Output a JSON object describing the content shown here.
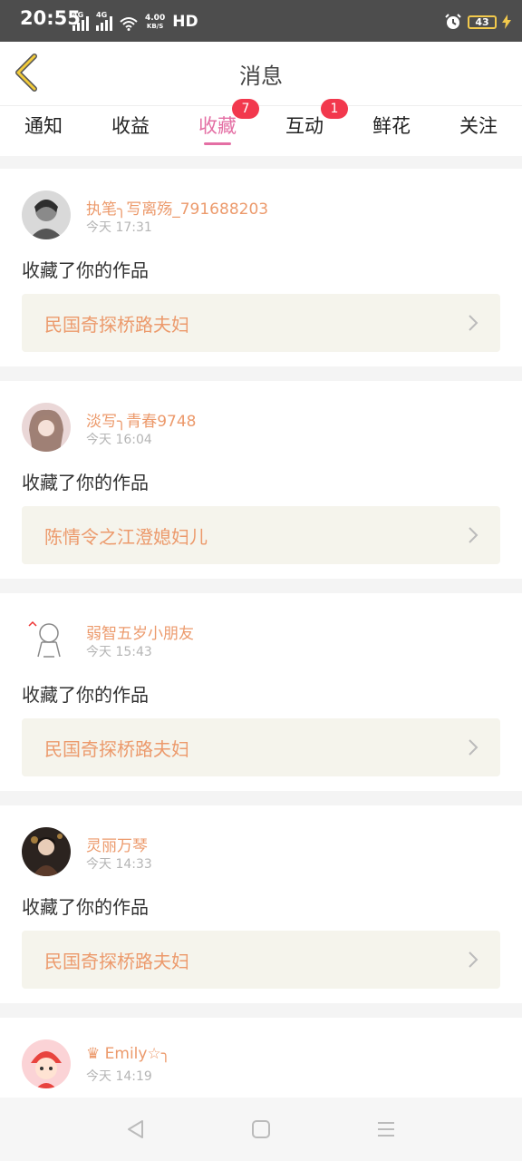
{
  "status": {
    "time": "20:55",
    "net1": "4G",
    "net2": "4G",
    "speed_value": "4.00",
    "speed_unit": "KB/S",
    "hd": "HD",
    "battery": "43"
  },
  "header": {
    "title": "消息"
  },
  "tabs": [
    {
      "label": "通知"
    },
    {
      "label": "收益"
    },
    {
      "label": "收藏",
      "badge": "7"
    },
    {
      "label": "互动",
      "badge": "1"
    },
    {
      "label": "鲜花"
    },
    {
      "label": "关注"
    }
  ],
  "feed": [
    {
      "user": "执笔╮写离殇_791688203",
      "time": "今天 17:31",
      "action": "收藏了你的作品",
      "work": "民国奇探桥路夫妇"
    },
    {
      "user": "淡写╮青春9748",
      "time": "今天 16:04",
      "action": "收藏了你的作品",
      "work": "陈情令之江澄媳妇儿"
    },
    {
      "user": "弱智五岁小朋友",
      "time": "今天 15:43",
      "action": "收藏了你的作品",
      "work": "民国奇探桥路夫妇"
    },
    {
      "user": "灵丽万琴",
      "time": "今天 14:33",
      "action": "收藏了你的作品",
      "work": "民国奇探桥路夫妇"
    },
    {
      "user": "♛ Emily☆╮",
      "time": "今天 14:19"
    }
  ]
}
